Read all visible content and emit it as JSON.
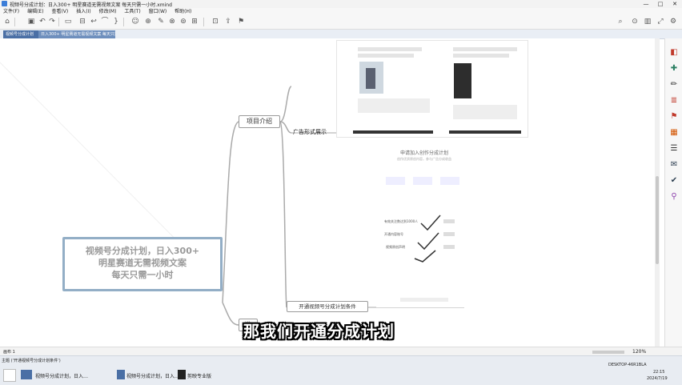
{
  "window": {
    "title": "视频号分成计划：日入300+ 明星赛道无需视频文案 每天只需一小时.xmind"
  },
  "menu": [
    "文件(F)",
    "编辑(E)",
    "查看(V)",
    "插入(I)",
    "修改(M)",
    "工具(T)",
    "窗口(W)",
    "帮助(H)"
  ],
  "tabs": [
    "视频号分成计划",
    "日入300+ 明星赛道无需视频文案 每天只需一小时"
  ],
  "mindmap": {
    "root": [
      "视频号分成计划，日入300+",
      "明星赛道无需视频文案",
      "每天只需一小时"
    ],
    "topic_intro": "项目介绍",
    "sub_ads": "广告形式展示",
    "sub_conditions": "开通视频号分成计划条件",
    "topic_partial": "准"
  },
  "form_shot": {
    "heading": "申请加入创作分成计划",
    "sub": "创作优质原创内容，参与广告分成收益",
    "items": [
      "有效关注数达到1000人",
      "开通内容账号",
      "视频原创声明"
    ]
  },
  "subtitle": "那我们开通分成计划",
  "status": {
    "left": "主题 (‘开通视频号分成计划条件’)",
    "zoom": "120%",
    "page": "画布 1",
    "machine": "DESKTOP-46R1BLA"
  },
  "taskbar": {
    "items": [
      "视频号分成计划，日入…",
      "视频号分成计划，日入…",
      "剪映专业版"
    ],
    "time": "22:15",
    "date": "2024/7/19"
  },
  "colors": {
    "root_border": "#93aec6",
    "tab": "#4a6fa5"
  }
}
